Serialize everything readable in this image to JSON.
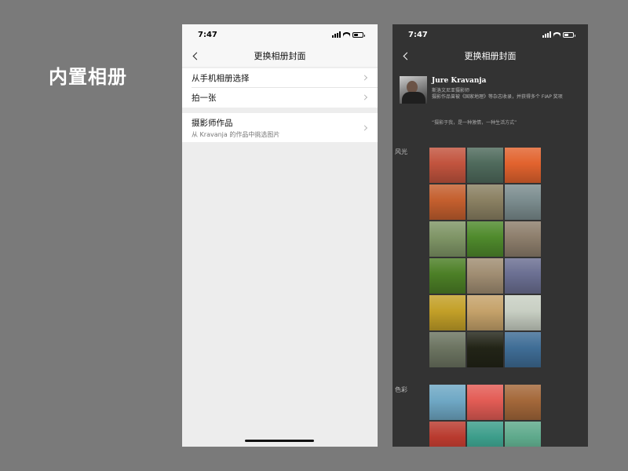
{
  "slide": {
    "title": "内置相册"
  },
  "status_time": "7:47",
  "light_screen": {
    "nav_title": "更换相册封面",
    "menu_group1": [
      {
        "label": "从手机相册选择"
      },
      {
        "label": "拍一张"
      }
    ],
    "menu_group2": {
      "label": "摄影师作品",
      "sub": "从 Kravanja 的作品中挑选图片"
    }
  },
  "dark_screen": {
    "nav_title": "更换相册封面",
    "photographer": {
      "name": "Jure Kravanja",
      "desc_line1": "斯洛文尼亚摄影师",
      "desc_line2": "摄影作品曾被《国家地理》等杂志收录，并获得多个 FIAP 奖项",
      "quote": "“摄影于我，是一种激情，一种生活方式”"
    },
    "sections": [
      {
        "label": "风光",
        "photos": [
          {
            "icon": "red-desert-butte-photo",
            "color": "#c2543e"
          },
          {
            "icon": "coast-aerial-photo",
            "color": "#4f6a5c"
          },
          {
            "icon": "orange-dune-photo",
            "color": "#e2632e"
          },
          {
            "icon": "sunset-silhouette-photo",
            "color": "#c45f2e"
          },
          {
            "icon": "valley-village-photo",
            "color": "#8a8062"
          },
          {
            "icon": "coastal-town-photo",
            "color": "#7b8c8e"
          },
          {
            "icon": "rolling-hills-photo",
            "color": "#7f9566"
          },
          {
            "icon": "green-field-house-photo",
            "color": "#4f8a2c"
          },
          {
            "icon": "misty-tree-photo",
            "color": "#8d7e6c"
          },
          {
            "icon": "lone-tree-meadow-photo",
            "color": "#4c7f26"
          },
          {
            "icon": "foggy-landscape-photo",
            "color": "#a08d72"
          },
          {
            "icon": "lavender-field-photo",
            "color": "#6b6f92"
          },
          {
            "icon": "sunflower-field-photo",
            "color": "#c3a028"
          },
          {
            "icon": "country-road-photo",
            "color": "#c5a26a"
          },
          {
            "icon": "winter-tree-photo",
            "color": "#c8cfc3"
          },
          {
            "icon": "storm-sky-photo",
            "color": "#6c7461"
          },
          {
            "icon": "night-mountain-photo",
            "color": "#222417"
          },
          {
            "icon": "blue-clouds-photo",
            "color": "#3f6d96"
          }
        ]
      },
      {
        "label": "色彩",
        "photos": [
          {
            "icon": "palm-street-photo",
            "color": "#6fa8c5"
          },
          {
            "icon": "red-roof-pipes-photo",
            "color": "#e35c55"
          },
          {
            "icon": "brown-facade-photo",
            "color": "#a4683a"
          },
          {
            "icon": "route-66-sign-photo",
            "color": "#b93a2e"
          },
          {
            "icon": "colorful-wall-photo",
            "color": "#3c9d8a"
          },
          {
            "icon": "green-building-photo",
            "color": "#5ea98b"
          }
        ]
      }
    ]
  }
}
